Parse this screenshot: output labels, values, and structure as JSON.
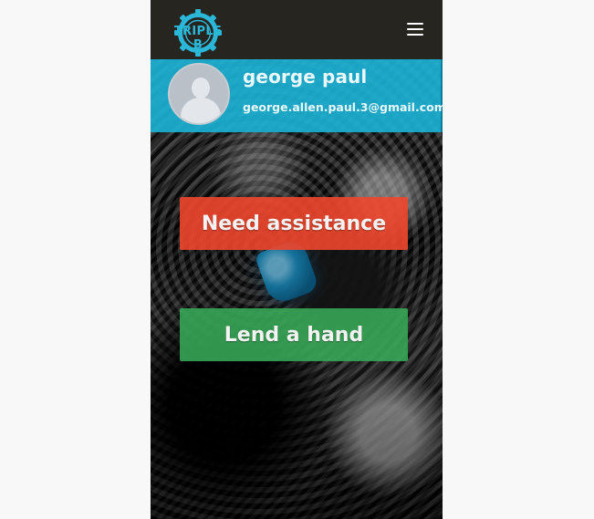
{
  "navbar": {
    "logo_text": "TRIPLE B",
    "menu_icon": "hamburger-menu-icon",
    "logo_icon": "gear-logo-icon",
    "background_color": "#27251f",
    "accent_color": "#2bb8d8"
  },
  "profile": {
    "name": "george paul",
    "email": "george.allen.paul.3@gmail.com",
    "avatar_icon": "default-avatar-icon",
    "banner_color": "#1bb2d6"
  },
  "actions": {
    "need_assistance_label": "Need assistance",
    "lend_a_hand_label": "Lend a hand",
    "need_assistance_color": "#f0462c",
    "lend_a_hand_color": "#39aa58"
  }
}
